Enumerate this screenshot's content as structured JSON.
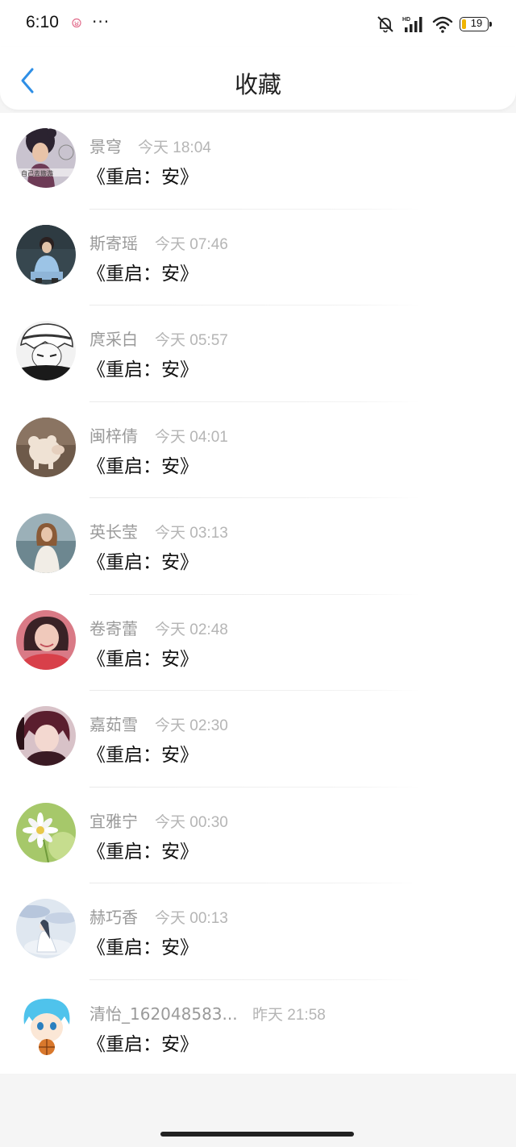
{
  "status_bar": {
    "time": "6:10",
    "dots": "···",
    "battery": "19",
    "colors": {
      "battery_fill": "#f0b400"
    }
  },
  "header": {
    "title": "收藏",
    "back_icon": "chevron-left-icon",
    "colors": {
      "back": "#2f8fe6"
    }
  },
  "items": [
    {
      "name": "景穹",
      "time": "今天 18:04",
      "title": "《重启：安》",
      "avatar": "girl-hat-avatar"
    },
    {
      "name": "斯寄瑶",
      "time": "今天 07:46",
      "title": "《重启：安》",
      "avatar": "boy-sitting-avatar"
    },
    {
      "name": "庹采白",
      "time": "今天 05:57",
      "title": "《重启：安》",
      "avatar": "anime-white-hair-avatar"
    },
    {
      "name": "闽梓倩",
      "time": "今天 04:01",
      "title": "《重启：安》",
      "avatar": "pig-plush-avatar"
    },
    {
      "name": "英长莹",
      "time": "今天 03:13",
      "title": "《重启：安》",
      "avatar": "woman-seaside-avatar"
    },
    {
      "name": "卷寄蕾",
      "time": "今天 02:48",
      "title": "《重启：安》",
      "avatar": "woman-portrait-avatar"
    },
    {
      "name": "嘉茹雪",
      "time": "今天 02:30",
      "title": "《重启：安》",
      "avatar": "anime-boy-avatar"
    },
    {
      "name": "宜雅宁",
      "time": "今天 00:30",
      "title": "《重启：安》",
      "avatar": "daisy-flower-avatar"
    },
    {
      "name": "赫巧香",
      "time": "今天 00:13",
      "title": "《重启：安》",
      "avatar": "girl-clouds-avatar"
    },
    {
      "name": "清怡_162048583...",
      "time": "昨天 21:58",
      "title": "《重启：安》",
      "avatar": "anime-basketball-avatar"
    }
  ]
}
